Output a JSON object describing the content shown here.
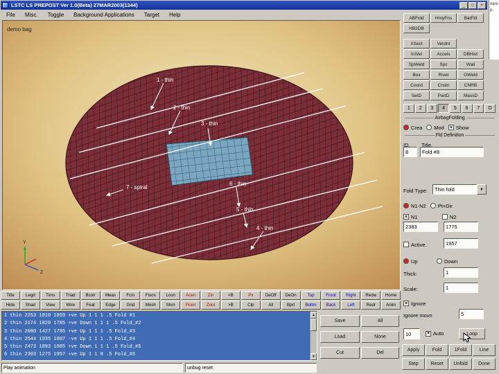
{
  "window": {
    "title": "LSTC LS PREPOST Ver 1.0(Beta)  27MAR2003(1344)",
    "controls": [
      "_",
      "□",
      "×"
    ]
  },
  "desktop_fragment": {
    "lines": [
      "vare",
      "p."
    ]
  },
  "menu": {
    "items": [
      "File",
      "Misc.",
      "Toggle",
      "Background Applications",
      "Target",
      "Help"
    ]
  },
  "viewport": {
    "model_label": "demo bag",
    "folds": [
      {
        "label": "1 - thin"
      },
      {
        "label": "2 - thin"
      },
      {
        "label": "3 - thin"
      },
      {
        "label": "7 - spiral"
      },
      {
        "label": "6 - thin"
      },
      {
        "label": "5 - thin"
      },
      {
        "label": "4 - thin"
      }
    ],
    "axes": {
      "y": "Y",
      "z": "Z"
    },
    "colors": {
      "bag": "#7c2e38",
      "patch": "#7ba6bf",
      "background_center": "#f0e8bc",
      "background_edge": "#bf8a50",
      "fold_line": "#ffffff"
    }
  },
  "toolbar": {
    "row1": [
      {
        "label": "Title"
      },
      {
        "label": "Legd"
      },
      {
        "label": "Tims"
      },
      {
        "label": "Triad"
      },
      {
        "label": "Bcolr"
      },
      {
        "label": "Meas"
      },
      {
        "label": "Fcm"
      },
      {
        "label": "Fisos"
      },
      {
        "label": "Lcon"
      },
      {
        "label": "Acen",
        "color": "#bb0000"
      },
      {
        "label": "Zin",
        "color": "#bb0000"
      },
      {
        "label": "<B"
      },
      {
        "label": "Px",
        "color": "#bb0000"
      },
      {
        "label": "DeOff"
      },
      {
        "label": "DeOn"
      },
      {
        "label": "Top",
        "color": "#0000bb"
      },
      {
        "label": "Front",
        "color": "#0000bb"
      },
      {
        "label": "Right",
        "color": "#0000bb"
      },
      {
        "label": "Redw"
      },
      {
        "label": "Home"
      }
    ],
    "row2": [
      {
        "label": "Hide"
      },
      {
        "label": "Shad"
      },
      {
        "label": "View"
      },
      {
        "label": "Wire"
      },
      {
        "label": "Feat"
      },
      {
        "label": "Edge"
      },
      {
        "label": "Grid"
      },
      {
        "label": "Mesh"
      },
      {
        "label": "Shrn"
      },
      {
        "label": "Pcen",
        "color": "#bb0000"
      },
      {
        "label": "Zout",
        "color": "#bb0000"
      },
      {
        "label": ">B"
      },
      {
        "label": "Clp"
      },
      {
        "label": "All"
      },
      {
        "label": "Bprt"
      },
      {
        "label": "Bottm",
        "color": "#0000bb"
      },
      {
        "label": "Back",
        "color": "#0000bb"
      },
      {
        "label": "Left",
        "color": "#0000bb"
      },
      {
        "label": "Redr"
      },
      {
        "label": "Anim"
      }
    ]
  },
  "fold_list": {
    "lines": [
      "1 thin 2253 1810 1859 +ve Up 1 1 1 .5 Fold #1",
      "2 thin 2174 1820 1785 +ve Down 1 1 1 .5 Fold_#2",
      "3 thin 2080 1427 1785 +ve Up 1 1 1 .5 Fold_#3",
      "4 thin 2544 1935 1807 -ve Up 1 1 1 .5 Fold_#4",
      "5 thin 2473 1893 1985 +ve Down 1 1 1 .5 Fold_#5",
      "6 thin 2303 1275 1957 +ve Up 1 1 0 .5 Fold_#6"
    ],
    "actions": {
      "save": "Save",
      "all": "All",
      "load": "Load",
      "none": "None",
      "cut": "Cut",
      "del": "Del"
    }
  },
  "status": {
    "left": "Play animation",
    "command": "unbug reset"
  },
  "right_panel": {
    "kw_rows": [
      [
        "ABFold",
        "HmyFns",
        "BatFld"
      ],
      [
        "HB2DB"
      ],
      [
        "XSect",
        "Verdnt"
      ],
      [
        "IniVel",
        "Accels",
        "DBHist"
      ],
      [
        "SpWeld",
        "Spc",
        "Wall"
      ],
      [
        "Box",
        "Rivet",
        "GWeld"
      ],
      [
        "Coord",
        "Cnstn",
        "CNRB"
      ],
      [
        "SetD",
        "PartD",
        "MassD"
      ]
    ],
    "pages": [
      "1",
      "2",
      "3",
      "4",
      "5",
      "6",
      "7",
      "D"
    ],
    "active_page": "4",
    "section_title": "AirbagFolding",
    "mode": {
      "create": "Crea",
      "modify": "Mod",
      "show": "Show"
    },
    "definition_title": "Fld Definition",
    "id_label": "ID.",
    "title_label": "Title.",
    "id_value": "8",
    "title_value": "Fold #8",
    "fold_type_label": "Fold Type:",
    "fold_type_value": "Thin fold",
    "point_mode": {
      "n1n2": "N1-N2",
      "ptdir": "Pt+Dir"
    },
    "n1_label": "N1",
    "n2_label": "N2",
    "n1_value": "2383",
    "n2_value": "1775",
    "active_label": "Active.",
    "active_value": "1957",
    "direction": {
      "up": "Up",
      "down": "Down"
    },
    "thick_label": "Thick:",
    "thick_value": "1",
    "scale_label": "Scale:",
    "scale_value": "1",
    "ignore_label": "Ignore",
    "ignore_movn_label": "Ignore movn",
    "ignore_movn_value": "5",
    "loop_count": "10",
    "auto_label": "Auto",
    "loop_label": "Loop",
    "actions_row1": [
      "Apply",
      "Fold",
      "1Fold",
      "Line"
    ],
    "actions_row2": [
      "Step",
      "Reset",
      "Unfold",
      "Done"
    ]
  }
}
